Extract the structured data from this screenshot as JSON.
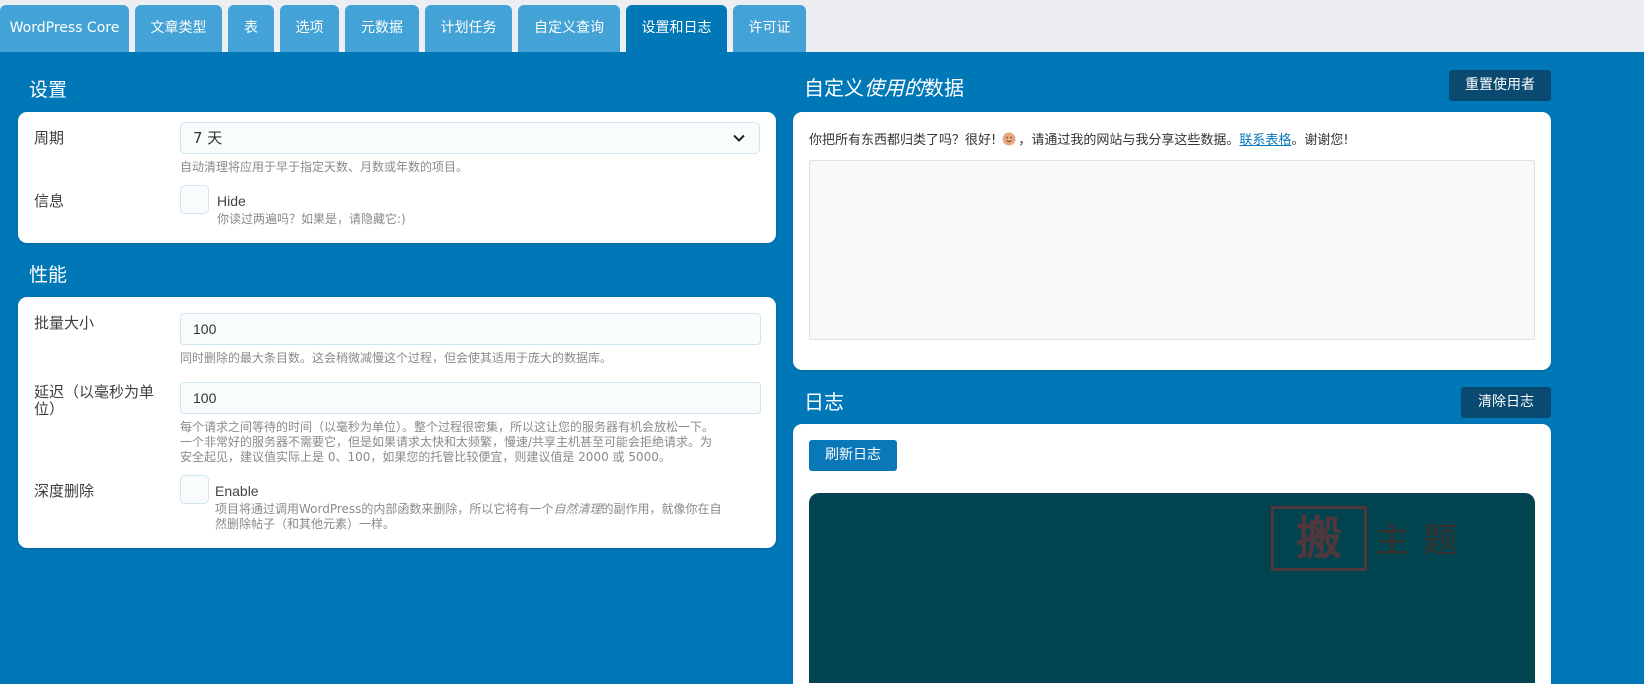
{
  "tabs": [
    {
      "label": "WordPress Core",
      "active": false
    },
    {
      "label": "文章类型",
      "active": false
    },
    {
      "label": "表",
      "active": false
    },
    {
      "label": "选项",
      "active": false
    },
    {
      "label": "元数据",
      "active": false
    },
    {
      "label": "计划任务",
      "active": false
    },
    {
      "label": "自定义查询",
      "active": false
    },
    {
      "label": "设置和日志",
      "active": true
    },
    {
      "label": "许可证",
      "active": false
    }
  ],
  "settings": {
    "title": "设置",
    "period_label": "周期",
    "period_value": "7 天",
    "period_help": "自动清理将应用于早于指定天数、月数或年数的项目。",
    "info_label": "信息",
    "info_checkbox_label": "Hide",
    "info_help": "你读过两遍吗？如果是，请隐藏它:)"
  },
  "performance": {
    "title": "性能",
    "batch_label": "批量大小",
    "batch_value": "100",
    "batch_help": "同时删除的最大条目数。这会稍微减慢这个过程，但会使其适用于庞大的数据库。",
    "delay_label_line1": "延迟（以毫秒为单",
    "delay_label_line2": "位）",
    "delay_value": "100",
    "delay_help_line1": "每个请求之间等待的时间（以毫秒为单位）。整个过程很密集，所以这让您的服务器有机会放松一下。",
    "delay_help_line2": "一个非常好的服务器不需要它，但是如果请求太快和太频繁，慢速/共享主机甚至可能会拒绝请求。为",
    "delay_help_line3": "安全起见，建议值实际上是 0、100，如果您的托管比较便宜，则建议值是 2000 或 5000。",
    "deep_label": "深度删除",
    "deep_checkbox_label": "Enable",
    "deep_help_pre": "项目将通过调用WordPress的内部函数来删除，所以它将有一个",
    "deep_help_em": "自然清理",
    "deep_help_post": "的副作用，就像你在自",
    "deep_help_line2": "然删除帖子（和其他元素）一样。"
  },
  "usage": {
    "title_pre": "自定义",
    "title_em": "使用的",
    "title_post": "数据",
    "reset_button": "重置使用者",
    "message_pre": "你把所有东西都归类了吗？很好!",
    "message_mid": "，请通过我的网站与我分享这些数据。",
    "message_link": "联系表格",
    "message_post": "。谢谢您!"
  },
  "log": {
    "title": "日志",
    "clear_button": "清除日志",
    "refresh_button": "刷新日志"
  },
  "watermark": {
    "seal_char": "搬",
    "text": "主题"
  },
  "colors": {
    "page_bg": "#0078b8",
    "tab_bg": "#43a2d6",
    "dark_button": "#0a4a70",
    "log_bg": "#024350"
  }
}
